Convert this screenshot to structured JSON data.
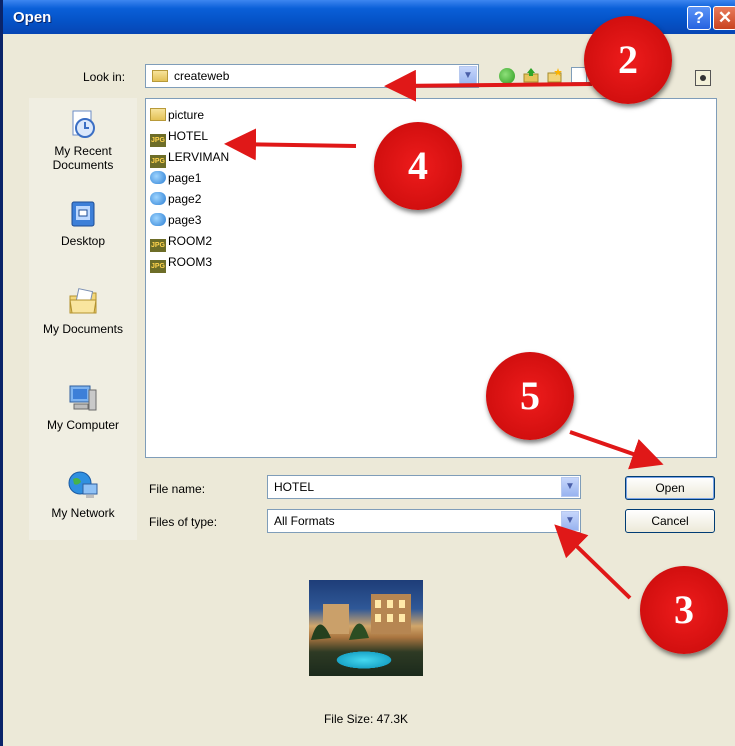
{
  "window": {
    "title": "Open"
  },
  "look_in": {
    "label": "Look in:",
    "value": "createweb"
  },
  "places": [
    {
      "label": "My Recent Documents",
      "icon": "recent-documents-icon"
    },
    {
      "label": "Desktop",
      "icon": "desktop-icon"
    },
    {
      "label": "My Documents",
      "icon": "my-documents-icon"
    },
    {
      "label": "My Computer",
      "icon": "my-computer-icon"
    },
    {
      "label": "My Network",
      "icon": "my-network-icon"
    }
  ],
  "files": [
    {
      "name": "picture",
      "type": "folder"
    },
    {
      "name": "HOTEL",
      "type": "jpg"
    },
    {
      "name": "LERVIMAN",
      "type": "jpg"
    },
    {
      "name": "page1",
      "type": "html"
    },
    {
      "name": "page2",
      "type": "html"
    },
    {
      "name": "page3",
      "type": "html"
    },
    {
      "name": "ROOM2",
      "type": "jpg"
    },
    {
      "name": "ROOM3",
      "type": "jpg"
    }
  ],
  "file_name": {
    "label": "File name:",
    "value": "HOTEL"
  },
  "file_type": {
    "label": "Files of type:",
    "value": "All Formats"
  },
  "buttons": {
    "open": "Open",
    "cancel": "Cancel"
  },
  "preview": {
    "file_size": "File Size: 47.3K"
  },
  "markers": {
    "m2": "2",
    "m3": "3",
    "m4": "4",
    "m5": "5"
  },
  "colors": {
    "marker": "#d20f0f",
    "titlebar": "#0553c8",
    "dialog": "#ece9d8"
  }
}
